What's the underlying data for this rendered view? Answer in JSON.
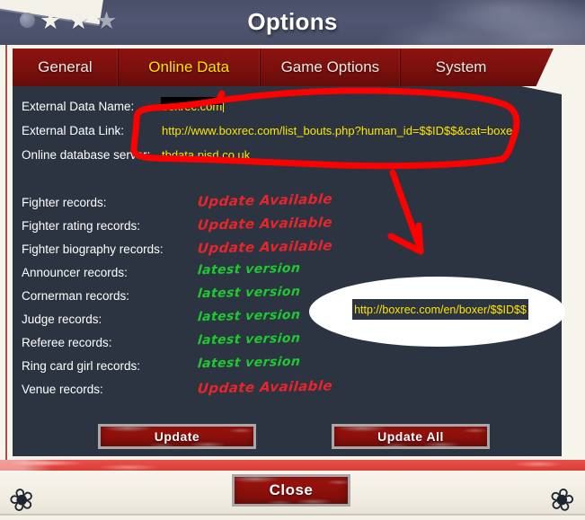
{
  "window": {
    "title": "Options",
    "stars": [
      "star-filled",
      "star-filled",
      "star-dim"
    ]
  },
  "tabs": [
    {
      "label": "General",
      "active": false
    },
    {
      "label": "Online Data",
      "active": true
    },
    {
      "label": "Game Options",
      "active": false
    },
    {
      "label": "System",
      "active": false
    }
  ],
  "fields": [
    {
      "label": "External Data Name:",
      "value": "boxrec.com"
    },
    {
      "label": "External Data Link:",
      "value": "http://www.boxrec.com/list_bouts.php?human_id=$$ID$$&cat=boxer"
    },
    {
      "label": "Online database server:",
      "value": "tbdata.pisd.co.uk"
    }
  ],
  "records": [
    {
      "label": "Fighter records:",
      "status": "Update Available",
      "state": "update"
    },
    {
      "label": "Fighter rating records:",
      "status": "Update Available",
      "state": "update"
    },
    {
      "label": "Fighter biography records:",
      "status": "Update Available",
      "state": "update"
    },
    {
      "label": "Announcer records:",
      "status": "latest version",
      "state": "latest"
    },
    {
      "label": "Cornerman records:",
      "status": "latest version",
      "state": "latest"
    },
    {
      "label": "Judge records:",
      "status": "latest version",
      "state": "latest"
    },
    {
      "label": "Referee records:",
      "status": "latest version",
      "state": "latest"
    },
    {
      "label": "Ring card girl records:",
      "status": "latest version",
      "state": "latest"
    },
    {
      "label": "Venue records:",
      "status": "Update Available",
      "state": "update"
    }
  ],
  "buttons": {
    "update": "Update",
    "update_all": "Update All",
    "close": "Close"
  },
  "annotation": {
    "callout_url": "http://boxrec.com/en/boxer/$$ID$$",
    "ink_color": "#ff0000",
    "shapes": [
      "circle-around-fields",
      "arrow-down-right",
      "ellipse-callout"
    ]
  },
  "colors": {
    "titlebar": "#4a4f68",
    "tab_red": "#7a100d",
    "panel": "#2b3440",
    "accent_yellow": "#ffe400",
    "status_update": "#e8252a",
    "status_latest": "#1fc931",
    "cream": "#f7f4ec",
    "stripe": "#e2443e"
  }
}
